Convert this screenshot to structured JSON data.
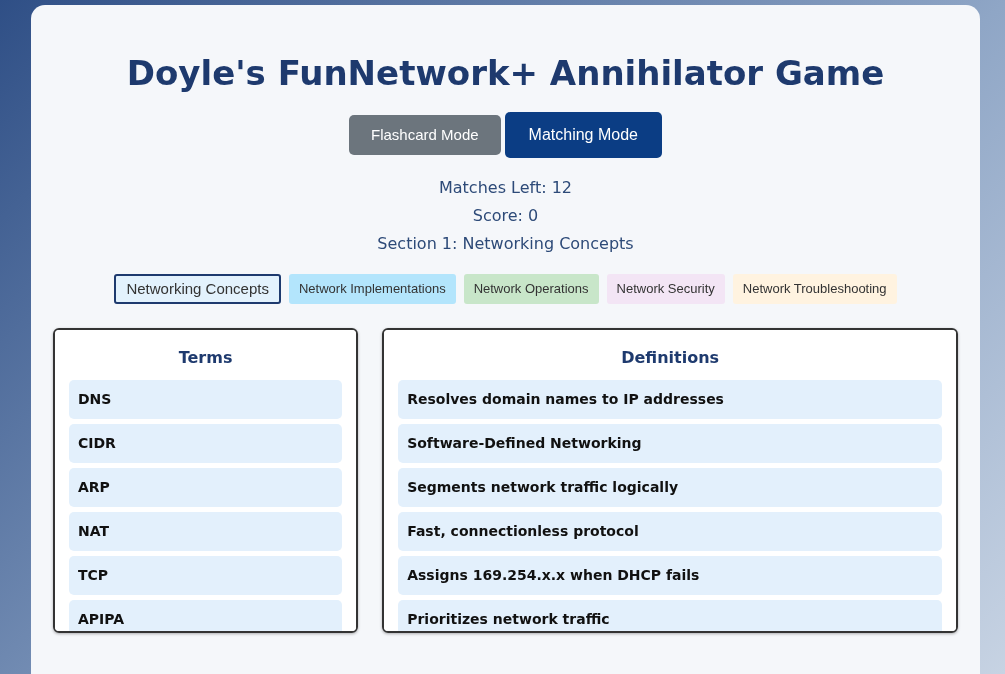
{
  "title": "Doyle's FunNetwork+ Annihilator Game",
  "modes": [
    {
      "label": "Flashcard Mode",
      "selected": false
    },
    {
      "label": "Matching Mode",
      "selected": true
    }
  ],
  "stats": [
    "Matches Left: 12",
    "Score: 0",
    "Section 1: Networking Concepts"
  ],
  "sections": [
    {
      "label": "Networking Concepts",
      "selected": true,
      "color": "#e3f2fd"
    },
    {
      "label": "Network Implementations",
      "selected": false,
      "color": "#b3e5fc"
    },
    {
      "label": "Network Operations",
      "selected": false,
      "color": "#c8e6c9"
    },
    {
      "label": "Network Security",
      "selected": false,
      "color": "#f3e5f5"
    },
    {
      "label": "Network Troubleshooting",
      "selected": false,
      "color": "#fff3e0"
    }
  ],
  "terms": {
    "heading": "Terms",
    "items": [
      "DNS",
      "CIDR",
      "ARP",
      "NAT",
      "TCP",
      "APIPA"
    ]
  },
  "definitions": {
    "heading": "Definitions",
    "items": [
      "Resolves domain names to IP addresses",
      "Software-Defined Networking",
      "Segments network traffic logically",
      "Fast, connectionless protocol",
      "Assigns 169.254.x.x when DHCP fails",
      "Prioritizes network traffic"
    ]
  }
}
